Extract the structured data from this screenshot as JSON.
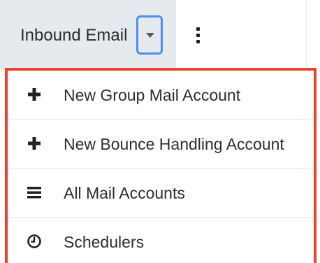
{
  "header": {
    "module_label": "Inbound Email",
    "caret_icon": "caret-down-icon",
    "actions_icon": "kebab-vertical-icon"
  },
  "menu": {
    "items": [
      {
        "label": "New Group Mail Account",
        "icon": "plus-icon"
      },
      {
        "label": "New Bounce Handling Account",
        "icon": "plus-icon"
      },
      {
        "label": "All Mail Accounts",
        "icon": "list-icon"
      },
      {
        "label": "Schedulers",
        "icon": "clock-icon"
      }
    ]
  },
  "colors": {
    "tab_background": "#e6e9ed",
    "focus_ring": "#4a8ff7",
    "highlight_border": "#e8452c",
    "text": "#2b2d2e"
  }
}
